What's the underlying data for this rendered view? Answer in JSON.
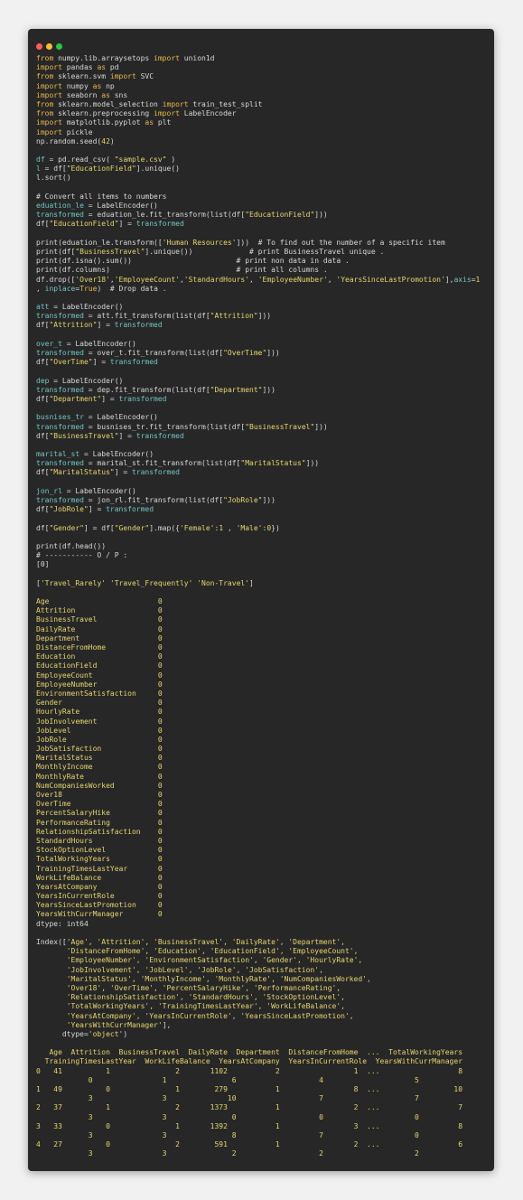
{
  "window": {
    "controls": [
      {
        "name": "close-dot",
        "color": "#ff5f57"
      },
      {
        "name": "minimize-dot",
        "color": "#febc2e"
      },
      {
        "name": "maximize-dot",
        "color": "#28c840"
      }
    ]
  },
  "colors": {
    "keyword": "#e8b84a",
    "module": "#e6d66f",
    "string": "#e6d66f",
    "variable": "#72c6c4",
    "text": "#d8d8d8",
    "background": "#272727"
  },
  "lines": [
    [
      [
        "kw",
        "from"
      ],
      [
        "t",
        " numpy.lib.arraysetops "
      ],
      [
        "kw",
        "import"
      ],
      [
        "t",
        " union1d"
      ]
    ],
    [
      [
        "kw",
        "import"
      ],
      [
        "t",
        " pandas "
      ],
      [
        "kw",
        "as"
      ],
      [
        "t",
        " pd"
      ]
    ],
    [
      [
        "kw",
        "from"
      ],
      [
        "t",
        " sklearn.svm "
      ],
      [
        "kw",
        "import"
      ],
      [
        "t",
        " SVC"
      ]
    ],
    [
      [
        "kw",
        "import"
      ],
      [
        "t",
        " numpy "
      ],
      [
        "kw",
        "as"
      ],
      [
        "t",
        " np"
      ]
    ],
    [
      [
        "kw",
        "import"
      ],
      [
        "t",
        " seaborn "
      ],
      [
        "kw",
        "as"
      ],
      [
        "t",
        " sns"
      ]
    ],
    [
      [
        "kw",
        "from"
      ],
      [
        "t",
        " sklearn.model_selection "
      ],
      [
        "kw",
        "import"
      ],
      [
        "t",
        " train_test_split"
      ]
    ],
    [
      [
        "kw",
        "from"
      ],
      [
        "t",
        " sklearn.preprocessing "
      ],
      [
        "kw",
        "import"
      ],
      [
        "t",
        " LabelEncoder"
      ]
    ],
    [
      [
        "kw",
        "import"
      ],
      [
        "t",
        " matplotlib.pyplot "
      ],
      [
        "kw",
        "as"
      ],
      [
        "t",
        " plt"
      ]
    ],
    [
      [
        "kw",
        "import"
      ],
      [
        "t",
        " pickle"
      ]
    ],
    [
      [
        "t",
        "np.random.seed("
      ],
      [
        "num",
        "42"
      ],
      [
        "t",
        ")"
      ]
    ],
    [
      [
        "t",
        ""
      ]
    ],
    [
      [
        "v",
        "df"
      ],
      [
        "t",
        " = pd.read_csv( "
      ],
      [
        "str",
        "\"sample.csv\""
      ],
      [
        "t",
        " )"
      ]
    ],
    [
      [
        "v",
        "l"
      ],
      [
        "t",
        " = df["
      ],
      [
        "str",
        "\"EducationField\""
      ],
      [
        "t",
        "].unique()"
      ]
    ],
    [
      [
        "t",
        "l.sort()"
      ]
    ],
    [
      [
        "t",
        ""
      ]
    ],
    [
      [
        "com",
        "# Convert all items to numbers"
      ]
    ],
    [
      [
        "v",
        "eduation_le"
      ],
      [
        "t",
        " = LabelEncoder()"
      ]
    ],
    [
      [
        "v",
        "transformed"
      ],
      [
        "t",
        " = eduation_le.fit_transform(list(df["
      ],
      [
        "str",
        "\"EducationField\""
      ],
      [
        "t",
        "]))"
      ]
    ],
    [
      [
        "t",
        "df["
      ],
      [
        "str",
        "\"EducationField\""
      ],
      [
        "t",
        "] = "
      ],
      [
        "v",
        "transformed"
      ]
    ],
    [
      [
        "t",
        ""
      ]
    ],
    [
      [
        "t",
        "print(eduation_le.transform(["
      ],
      [
        "str",
        "'Human Resources'"
      ],
      [
        "t",
        "]))  # To find out the number of a specific item"
      ]
    ],
    [
      [
        "t",
        "print(df["
      ],
      [
        "str",
        "\"BusinessTravel\""
      ],
      [
        "t",
        "].unique())             # print BusinessTravel unique ."
      ]
    ],
    [
      [
        "t",
        "print(df.isna().sum())                        # print non data in data ."
      ]
    ],
    [
      [
        "t",
        "print(df.columns)                             # print all columns ."
      ]
    ],
    [
      [
        "t",
        "df.drop(["
      ],
      [
        "str",
        "'Over18'"
      ],
      [
        "t",
        ","
      ],
      [
        "str",
        "'EmployeeCount'"
      ],
      [
        "t",
        ","
      ],
      [
        "str",
        "'StandardHours'"
      ],
      [
        "t",
        ", "
      ],
      [
        "str",
        "'EmployeeNumber'"
      ],
      [
        "t",
        ", "
      ],
      [
        "str",
        "'YearsSinceLastPromotion'"
      ],
      [
        "t",
        "],"
      ],
      [
        "v",
        "axis"
      ],
      [
        "t",
        "="
      ],
      [
        "num",
        "1"
      ]
    ],
    [
      [
        "t",
        ", "
      ],
      [
        "v",
        "inplace"
      ],
      [
        "t",
        "="
      ],
      [
        "kw",
        "True"
      ],
      [
        "t",
        ")  # Drop data ."
      ]
    ],
    [
      [
        "t",
        ""
      ]
    ],
    [
      [
        "v",
        "att"
      ],
      [
        "t",
        " = LabelEncoder()"
      ]
    ],
    [
      [
        "v",
        "transformed"
      ],
      [
        "t",
        " = att.fit_transform(list(df["
      ],
      [
        "str",
        "\"Attrition\""
      ],
      [
        "t",
        "]))"
      ]
    ],
    [
      [
        "t",
        "df["
      ],
      [
        "str",
        "\"Attrition\""
      ],
      [
        "t",
        "] = "
      ],
      [
        "v",
        "transformed"
      ]
    ],
    [
      [
        "t",
        ""
      ]
    ],
    [
      [
        "v",
        "over_t"
      ],
      [
        "t",
        " = LabelEncoder()"
      ]
    ],
    [
      [
        "v",
        "transformed"
      ],
      [
        "t",
        " = over_t.fit_transform(list(df["
      ],
      [
        "str",
        "\"OverTime\""
      ],
      [
        "t",
        "]))"
      ]
    ],
    [
      [
        "t",
        "df["
      ],
      [
        "str",
        "\"OverTime\""
      ],
      [
        "t",
        "] = "
      ],
      [
        "v",
        "transformed"
      ]
    ],
    [
      [
        "t",
        ""
      ]
    ],
    [
      [
        "v",
        "dep"
      ],
      [
        "t",
        " = LabelEncoder()"
      ]
    ],
    [
      [
        "v",
        "transformed"
      ],
      [
        "t",
        " = dep.fit_transform(list(df["
      ],
      [
        "str",
        "\"Department\""
      ],
      [
        "t",
        "]))"
      ]
    ],
    [
      [
        "t",
        "df["
      ],
      [
        "str",
        "\"Department\""
      ],
      [
        "t",
        "] = "
      ],
      [
        "v",
        "transformed"
      ]
    ],
    [
      [
        "t",
        ""
      ]
    ],
    [
      [
        "v",
        "busnises_tr"
      ],
      [
        "t",
        " = LabelEncoder()"
      ]
    ],
    [
      [
        "v",
        "transformed"
      ],
      [
        "t",
        " = busnises_tr.fit_transform(list(df["
      ],
      [
        "str",
        "\"BusinessTravel\""
      ],
      [
        "t",
        "]))"
      ]
    ],
    [
      [
        "t",
        "df["
      ],
      [
        "str",
        "\"BusinessTravel\""
      ],
      [
        "t",
        "] = "
      ],
      [
        "v",
        "transformed"
      ]
    ],
    [
      [
        "t",
        ""
      ]
    ],
    [
      [
        "v",
        "marital_st"
      ],
      [
        "t",
        " = LabelEncoder()"
      ]
    ],
    [
      [
        "v",
        "transformed"
      ],
      [
        "t",
        " = marital_st.fit_transform(list(df["
      ],
      [
        "str",
        "\"MaritalStatus\""
      ],
      [
        "t",
        "]))"
      ]
    ],
    [
      [
        "t",
        "df["
      ],
      [
        "str",
        "\"MaritalStatus\""
      ],
      [
        "t",
        "] = "
      ],
      [
        "v",
        "transformed"
      ]
    ],
    [
      [
        "t",
        ""
      ]
    ],
    [
      [
        "v",
        "jon_rl"
      ],
      [
        "t",
        " = LabelEncoder()"
      ]
    ],
    [
      [
        "v",
        "transformed"
      ],
      [
        "t",
        " = jon_rl.fit_transform(list(df["
      ],
      [
        "str",
        "\"JobRole\""
      ],
      [
        "t",
        "]))"
      ]
    ],
    [
      [
        "t",
        "df["
      ],
      [
        "str",
        "\"JobRole\""
      ],
      [
        "t",
        "] = "
      ],
      [
        "v",
        "transformed"
      ]
    ],
    [
      [
        "t",
        ""
      ]
    ],
    [
      [
        "t",
        "df["
      ],
      [
        "str",
        "\"Gender\""
      ],
      [
        "t",
        "] = df["
      ],
      [
        "str",
        "\"Gender\""
      ],
      [
        "t",
        "].map({"
      ],
      [
        "str",
        "'Female'"
      ],
      [
        "t",
        ":"
      ],
      [
        "num",
        "1"
      ],
      [
        "t",
        " , "
      ],
      [
        "str",
        "'Male'"
      ],
      [
        "t",
        ":"
      ],
      [
        "num",
        "0"
      ],
      [
        "t",
        "})"
      ]
    ],
    [
      [
        "t",
        ""
      ]
    ],
    [
      [
        "t",
        "print(df.head())"
      ]
    ],
    [
      [
        "com",
        "# ----------- O / P :"
      ]
    ],
    [
      [
        "t",
        "[0]"
      ]
    ],
    [
      [
        "t",
        ""
      ]
    ],
    [
      [
        "t",
        "["
      ],
      [
        "str",
        "'Travel_Rarely' 'Travel_Frequently' 'Non-Travel'"
      ],
      [
        "t",
        "]"
      ]
    ],
    [
      [
        "t",
        ""
      ]
    ],
    [
      [
        "out",
        "Age                         0"
      ]
    ],
    [
      [
        "out",
        "Attrition                   0"
      ]
    ],
    [
      [
        "out",
        "BusinessTravel              0"
      ]
    ],
    [
      [
        "out",
        "DailyRate                   0"
      ]
    ],
    [
      [
        "out",
        "Department                  0"
      ]
    ],
    [
      [
        "out",
        "DistanceFromHome            0"
      ]
    ],
    [
      [
        "out",
        "Education                   0"
      ]
    ],
    [
      [
        "out",
        "EducationField              0"
      ]
    ],
    [
      [
        "out",
        "EmployeeCount               0"
      ]
    ],
    [
      [
        "out",
        "EmployeeNumber              0"
      ]
    ],
    [
      [
        "out",
        "EnvironmentSatisfaction     0"
      ]
    ],
    [
      [
        "out",
        "Gender                      0"
      ]
    ],
    [
      [
        "out",
        "HourlyRate                  0"
      ]
    ],
    [
      [
        "out",
        "JobInvolvement              0"
      ]
    ],
    [
      [
        "out",
        "JobLevel                    0"
      ]
    ],
    [
      [
        "out",
        "JobRole                     0"
      ]
    ],
    [
      [
        "out",
        "JobSatisfaction             0"
      ]
    ],
    [
      [
        "out",
        "MaritalStatus               0"
      ]
    ],
    [
      [
        "out",
        "MonthlyIncome               0"
      ]
    ],
    [
      [
        "out",
        "MonthlyRate                 0"
      ]
    ],
    [
      [
        "out",
        "NumCompaniesWorked          0"
      ]
    ],
    [
      [
        "out",
        "Over18                      0"
      ]
    ],
    [
      [
        "out",
        "OverTime                    0"
      ]
    ],
    [
      [
        "out",
        "PercentSalaryHike           0"
      ]
    ],
    [
      [
        "out",
        "PerformanceRating           0"
      ]
    ],
    [
      [
        "out",
        "RelationshipSatisfaction    0"
      ]
    ],
    [
      [
        "out",
        "StandardHours               0"
      ]
    ],
    [
      [
        "out",
        "StockOptionLevel            0"
      ]
    ],
    [
      [
        "out",
        "TotalWorkingYears           0"
      ]
    ],
    [
      [
        "out",
        "TrainingTimesLastYear       0"
      ]
    ],
    [
      [
        "out",
        "WorkLifeBalance             0"
      ]
    ],
    [
      [
        "out",
        "YearsAtCompany              0"
      ]
    ],
    [
      [
        "out",
        "YearsInCurrentRole          0"
      ]
    ],
    [
      [
        "out",
        "YearsSinceLastPromotion     0"
      ]
    ],
    [
      [
        "out",
        "YearsWithCurrManager        0"
      ]
    ],
    [
      [
        "t",
        "dtype: int64"
      ]
    ],
    [
      [
        "t",
        ""
      ]
    ],
    [
      [
        "t",
        "Index(["
      ],
      [
        "str",
        "'Age', 'Attrition', 'BusinessTravel', 'DailyRate', 'Department',"
      ]
    ],
    [
      [
        "str",
        "       'DistanceFromHome', 'Education', 'EducationField', 'EmployeeCount',"
      ]
    ],
    [
      [
        "str",
        "       'EmployeeNumber', 'EnvironmentSatisfaction', 'Gender', 'HourlyRate',"
      ]
    ],
    [
      [
        "str",
        "       'JobInvolvement', 'JobLevel', 'JobRole', 'JobSatisfaction',"
      ]
    ],
    [
      [
        "str",
        "       'MaritalStatus', 'MonthlyIncome', 'MonthlyRate', 'NumCompaniesWorked',"
      ]
    ],
    [
      [
        "str",
        "       'Over18', 'OverTime', 'PercentSalaryHike', 'PerformanceRating',"
      ]
    ],
    [
      [
        "str",
        "       'RelationshipSatisfaction', 'StandardHours', 'StockOptionLevel',"
      ]
    ],
    [
      [
        "str",
        "       'TotalWorkingYears', 'TrainingTimesLastYear', 'WorkLifeBalance',"
      ]
    ],
    [
      [
        "str",
        "       'YearsAtCompany', 'YearsInCurrentRole', 'YearsSinceLastPromotion',"
      ]
    ],
    [
      [
        "str",
        "       'YearsWithCurrManager'"
      ],
      [
        "t",
        "],"
      ]
    ],
    [
      [
        "t",
        "      dtype="
      ],
      [
        "str",
        "'object'"
      ],
      [
        "t",
        ")"
      ]
    ],
    [
      [
        "t",
        ""
      ]
    ],
    [
      [
        "out",
        "   Age  Attrition  BusinessTravel  DailyRate  Department  DistanceFromHome  ...  TotalWorkingYears"
      ]
    ],
    [
      [
        "out",
        "  TrainingTimesLastYear  WorkLifeBalance  YearsAtCompany  YearsInCurrentRole  YearsWithCurrManager"
      ]
    ],
    [
      [
        "out",
        "0   41          1               2       1102           2                 1  ...                  8"
      ]
    ],
    [
      [
        "out",
        "            0                1               6                   4                     5"
      ]
    ],
    [
      [
        "out",
        "1   49          0               1        279           1                 8  ...                 10"
      ]
    ],
    [
      [
        "out",
        "            3                3              10                   7                     7"
      ]
    ],
    [
      [
        "out",
        "2   37          1               2       1373           1                 2  ...                  7"
      ]
    ],
    [
      [
        "out",
        "            3                3               0                   0                     0"
      ]
    ],
    [
      [
        "out",
        "3   33          0               1       1392           1                 3  ...                  8"
      ]
    ],
    [
      [
        "out",
        "            3                3               8                   7                     0"
      ]
    ],
    [
      [
        "out",
        "4   27          0               2        591           1                 2  ...                  6"
      ]
    ],
    [
      [
        "out",
        "            3                3               2                   2                     2"
      ]
    ]
  ]
}
